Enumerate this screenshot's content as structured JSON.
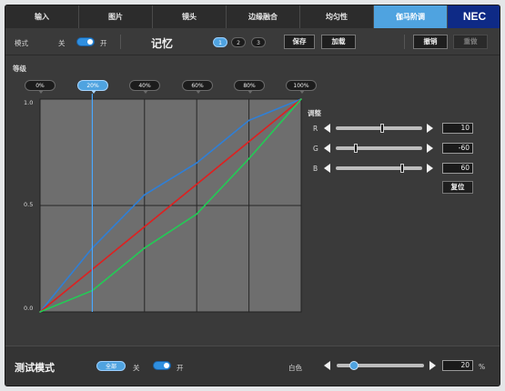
{
  "tabs": [
    {
      "label": "输入",
      "active": false
    },
    {
      "label": "图片",
      "active": false
    },
    {
      "label": "镜头",
      "active": false
    },
    {
      "label": "边缘融合",
      "active": false
    },
    {
      "label": "均匀性",
      "active": false
    },
    {
      "label": "伽马阶调",
      "active": true
    }
  ],
  "brand": "NEC",
  "toolbar": {
    "mode_label": "模式",
    "off_label": "关",
    "on_label": "开",
    "memory_title": "记忆",
    "memory_slots": [
      "1",
      "2",
      "3"
    ],
    "active_slot": "1",
    "save_label": "保存",
    "load_label": "加载",
    "undo_label": "撤销",
    "redo_label": "重做"
  },
  "chart_data": {
    "type": "line",
    "title": "等级",
    "x": [
      0,
      20,
      40,
      60,
      80,
      100
    ],
    "x_tick_labels": [
      "0%",
      "20%",
      "40%",
      "60%",
      "80%",
      "100%"
    ],
    "active_point": "20%",
    "y_tick_labels": [
      "1.0",
      "0.5",
      "0.0"
    ],
    "ylim": [
      0,
      1
    ],
    "grid": true,
    "series": [
      {
        "color": "#2f7fd6",
        "values": [
          0.0,
          0.3,
          0.55,
          0.7,
          0.9,
          1.0
        ]
      },
      {
        "color": "#e01f1f",
        "values": [
          0.0,
          0.2,
          0.4,
          0.6,
          0.8,
          1.0
        ]
      },
      {
        "color": "#22cc55",
        "values": [
          0.0,
          0.1,
          0.3,
          0.46,
          0.72,
          1.0
        ]
      }
    ],
    "cursor_color": "#4aa8ff"
  },
  "adjust": {
    "title": "调整",
    "rows": [
      {
        "label": "R",
        "value": "10",
        "fraction": 0.54
      },
      {
        "label": "G",
        "value": "-60",
        "fraction": 0.23
      },
      {
        "label": "B",
        "value": "60",
        "fraction": 0.77
      }
    ],
    "reset_label": "复位"
  },
  "test_mode": {
    "title": "测试模式",
    "all_label": "全部",
    "off_label": "关",
    "on_label": "开",
    "white_label": "白色",
    "value": "20",
    "unit": "%",
    "fraction": 0.2
  },
  "colors": {
    "accent": "#4fa3e0",
    "brand_bg": "#0e2a86",
    "panel_bg": "#3a3a3a",
    "plot_bg": "#6e6e6e"
  }
}
